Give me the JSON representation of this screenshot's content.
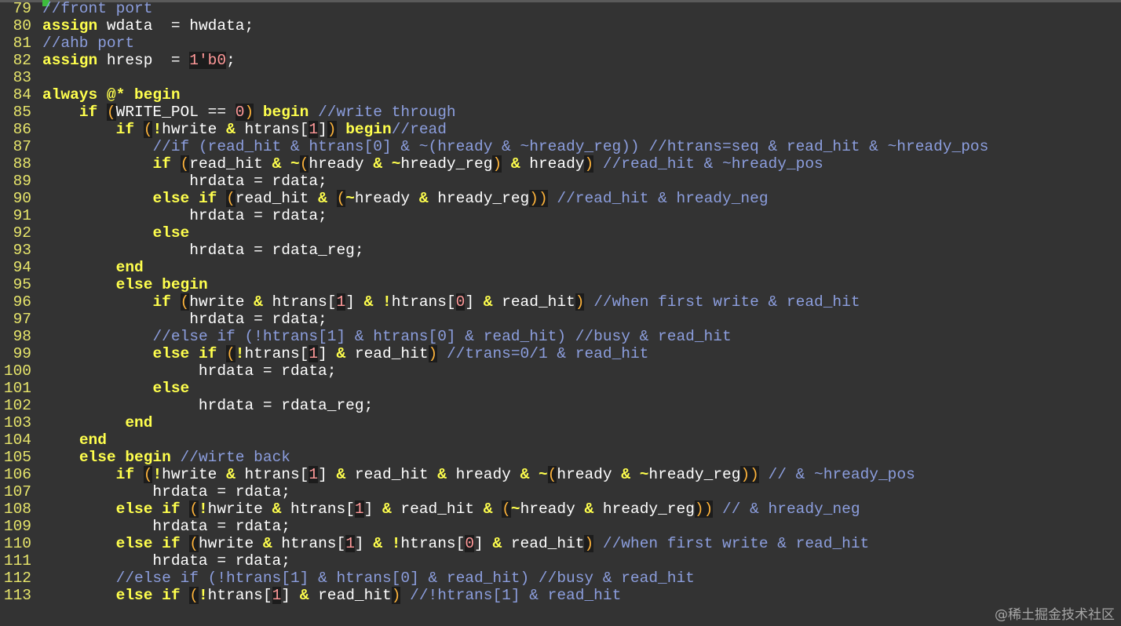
{
  "editor": {
    "watermark": "@稀土掘金技术社区",
    "lines": [
      {
        "n": "79",
        "tokens": [
          [
            "cm",
            "//front port"
          ]
        ]
      },
      {
        "n": "80",
        "tokens": [
          [
            "kw",
            "assign"
          ],
          [
            "id",
            " wdata  = hwdata;"
          ]
        ]
      },
      {
        "n": "81",
        "tokens": [
          [
            "cm",
            "//ahb port"
          ]
        ]
      },
      {
        "n": "82",
        "tokens": [
          [
            "kw",
            "assign"
          ],
          [
            "id",
            " hresp  = "
          ],
          [
            "num",
            "1'b0"
          ],
          [
            "id",
            ";"
          ]
        ]
      },
      {
        "n": "83",
        "tokens": []
      },
      {
        "n": "84",
        "tokens": [
          [
            "kw",
            "always @* begin"
          ]
        ]
      },
      {
        "n": "85",
        "tokens": [
          [
            "id",
            "    "
          ],
          [
            "kw",
            "if"
          ],
          [
            "id",
            " "
          ],
          [
            "br",
            "("
          ],
          [
            "id",
            "WRITE_POL == "
          ],
          [
            "num",
            "0"
          ],
          [
            "br",
            ")"
          ],
          [
            "id",
            " "
          ],
          [
            "kw",
            "begin"
          ],
          [
            "id",
            " "
          ],
          [
            "cm",
            "//write through"
          ]
        ]
      },
      {
        "n": "86",
        "tokens": [
          [
            "id",
            "        "
          ],
          [
            "kw",
            "if"
          ],
          [
            "id",
            " "
          ],
          [
            "br",
            "("
          ],
          [
            "kw",
            "!"
          ],
          [
            "id",
            "hwrite "
          ],
          [
            "kw",
            "&"
          ],
          [
            "id",
            " htrans["
          ],
          [
            "num",
            "1"
          ],
          [
            "id",
            "]"
          ],
          [
            "br",
            ")"
          ],
          [
            "id",
            " "
          ],
          [
            "kw",
            "begin"
          ],
          [
            "cm",
            "//read"
          ]
        ]
      },
      {
        "n": "87",
        "tokens": [
          [
            "id",
            "            "
          ],
          [
            "cm",
            "//if (read_hit & htrans[0] & ~(hready & ~hready_reg)) //htrans=seq & read_hit & ~hready_pos"
          ]
        ]
      },
      {
        "n": "88",
        "tokens": [
          [
            "id",
            "            "
          ],
          [
            "kw",
            "if"
          ],
          [
            "id",
            " "
          ],
          [
            "br",
            "("
          ],
          [
            "id",
            "read_hit "
          ],
          [
            "kw",
            "&"
          ],
          [
            "id",
            " "
          ],
          [
            "kw",
            "~"
          ],
          [
            "br",
            "("
          ],
          [
            "id",
            "hready "
          ],
          [
            "kw",
            "&"
          ],
          [
            "id",
            " "
          ],
          [
            "kw",
            "~"
          ],
          [
            "id",
            "hready_reg"
          ],
          [
            "br",
            ")"
          ],
          [
            "id",
            " "
          ],
          [
            "kw",
            "&"
          ],
          [
            "id",
            " hready"
          ],
          [
            "br",
            ")"
          ],
          [
            "id",
            " "
          ],
          [
            "cm",
            "//read_hit & ~hready_pos"
          ]
        ]
      },
      {
        "n": "89",
        "tokens": [
          [
            "id",
            "                hrdata = rdata;"
          ]
        ]
      },
      {
        "n": "90",
        "tokens": [
          [
            "id",
            "            "
          ],
          [
            "kw",
            "else if"
          ],
          [
            "id",
            " "
          ],
          [
            "br",
            "("
          ],
          [
            "id",
            "read_hit "
          ],
          [
            "kw",
            "&"
          ],
          [
            "id",
            " "
          ],
          [
            "br",
            "("
          ],
          [
            "kw",
            "~"
          ],
          [
            "id",
            "hready "
          ],
          [
            "kw",
            "&"
          ],
          [
            "id",
            " hready_reg"
          ],
          [
            "br",
            "))"
          ],
          [
            "id",
            " "
          ],
          [
            "cm",
            "//read_hit & hready_neg"
          ]
        ]
      },
      {
        "n": "91",
        "tokens": [
          [
            "id",
            "                hrdata = rdata;"
          ]
        ]
      },
      {
        "n": "92",
        "tokens": [
          [
            "id",
            "            "
          ],
          [
            "kw",
            "else"
          ]
        ]
      },
      {
        "n": "93",
        "tokens": [
          [
            "id",
            "                hrdata = rdata_reg;"
          ]
        ]
      },
      {
        "n": "94",
        "tokens": [
          [
            "id",
            "        "
          ],
          [
            "kw",
            "end"
          ]
        ]
      },
      {
        "n": "95",
        "tokens": [
          [
            "id",
            "        "
          ],
          [
            "kw",
            "else begin"
          ]
        ]
      },
      {
        "n": "96",
        "tokens": [
          [
            "id",
            "            "
          ],
          [
            "kw",
            "if"
          ],
          [
            "id",
            " "
          ],
          [
            "br",
            "("
          ],
          [
            "id",
            "hwrite "
          ],
          [
            "kw",
            "&"
          ],
          [
            "id",
            " htrans["
          ],
          [
            "num",
            "1"
          ],
          [
            "id",
            "] "
          ],
          [
            "kw",
            "&"
          ],
          [
            "id",
            " "
          ],
          [
            "kw",
            "!"
          ],
          [
            "id",
            "htrans["
          ],
          [
            "num",
            "0"
          ],
          [
            "id",
            "] "
          ],
          [
            "kw",
            "&"
          ],
          [
            "id",
            " read_hit"
          ],
          [
            "br",
            ")"
          ],
          [
            "id",
            " "
          ],
          [
            "cm",
            "//when first write & read_hit"
          ]
        ]
      },
      {
        "n": "97",
        "tokens": [
          [
            "id",
            "                hrdata = rdata;"
          ]
        ]
      },
      {
        "n": "98",
        "tokens": [
          [
            "id",
            "            "
          ],
          [
            "cm",
            "//else if (!htrans[1] & htrans[0] & read_hit) //busy & read_hit"
          ]
        ]
      },
      {
        "n": "99",
        "tokens": [
          [
            "id",
            "            "
          ],
          [
            "kw",
            "else if"
          ],
          [
            "id",
            " "
          ],
          [
            "br",
            "("
          ],
          [
            "kw",
            "!"
          ],
          [
            "id",
            "htrans["
          ],
          [
            "num",
            "1"
          ],
          [
            "id",
            "] "
          ],
          [
            "kw",
            "&"
          ],
          [
            "id",
            " read_hit"
          ],
          [
            "br",
            ")"
          ],
          [
            "id",
            " "
          ],
          [
            "cm",
            "//trans=0/1 & read_hit"
          ]
        ]
      },
      {
        "n": "100",
        "tokens": [
          [
            "id",
            "                 hrdata = rdata;"
          ]
        ]
      },
      {
        "n": "101",
        "tokens": [
          [
            "id",
            "            "
          ],
          [
            "kw",
            "else"
          ]
        ]
      },
      {
        "n": "102",
        "tokens": [
          [
            "id",
            "                 hrdata = rdata_reg;"
          ]
        ]
      },
      {
        "n": "103",
        "tokens": [
          [
            "id",
            "         "
          ],
          [
            "kw",
            "end"
          ]
        ]
      },
      {
        "n": "104",
        "tokens": [
          [
            "id",
            "    "
          ],
          [
            "kw",
            "end"
          ]
        ]
      },
      {
        "n": "105",
        "tokens": [
          [
            "id",
            "    "
          ],
          [
            "kw",
            "else begin"
          ],
          [
            "id",
            " "
          ],
          [
            "cm",
            "//wirte back"
          ]
        ]
      },
      {
        "n": "106",
        "tokens": [
          [
            "id",
            "        "
          ],
          [
            "kw",
            "if"
          ],
          [
            "id",
            " "
          ],
          [
            "br",
            "("
          ],
          [
            "kw",
            "!"
          ],
          [
            "id",
            "hwrite "
          ],
          [
            "kw",
            "&"
          ],
          [
            "id",
            " htrans["
          ],
          [
            "num",
            "1"
          ],
          [
            "id",
            "] "
          ],
          [
            "kw",
            "&"
          ],
          [
            "id",
            " read_hit "
          ],
          [
            "kw",
            "&"
          ],
          [
            "id",
            " hready "
          ],
          [
            "kw",
            "&"
          ],
          [
            "id",
            " "
          ],
          [
            "kw",
            "~"
          ],
          [
            "br",
            "("
          ],
          [
            "id",
            "hready "
          ],
          [
            "kw",
            "&"
          ],
          [
            "id",
            " "
          ],
          [
            "kw",
            "~"
          ],
          [
            "id",
            "hready_reg"
          ],
          [
            "br",
            "))"
          ],
          [
            "id",
            " "
          ],
          [
            "cm",
            "// & ~hready_pos"
          ]
        ]
      },
      {
        "n": "107",
        "tokens": [
          [
            "id",
            "            hrdata = rdata;"
          ]
        ]
      },
      {
        "n": "108",
        "tokens": [
          [
            "id",
            "        "
          ],
          [
            "kw",
            "else if"
          ],
          [
            "id",
            " "
          ],
          [
            "br",
            "("
          ],
          [
            "kw",
            "!"
          ],
          [
            "id",
            "hwrite "
          ],
          [
            "kw",
            "&"
          ],
          [
            "id",
            " htrans["
          ],
          [
            "num",
            "1"
          ],
          [
            "id",
            "] "
          ],
          [
            "kw",
            "&"
          ],
          [
            "id",
            " read_hit "
          ],
          [
            "kw",
            "&"
          ],
          [
            "id",
            " "
          ],
          [
            "br",
            "("
          ],
          [
            "kw",
            "~"
          ],
          [
            "id",
            "hready "
          ],
          [
            "kw",
            "&"
          ],
          [
            "id",
            " hready_reg"
          ],
          [
            "br",
            "))"
          ],
          [
            "id",
            " "
          ],
          [
            "cm",
            "// & hready_neg"
          ]
        ]
      },
      {
        "n": "109",
        "tokens": [
          [
            "id",
            "            hrdata = rdata;"
          ]
        ]
      },
      {
        "n": "110",
        "tokens": [
          [
            "id",
            "        "
          ],
          [
            "kw",
            "else if"
          ],
          [
            "id",
            " "
          ],
          [
            "br",
            "("
          ],
          [
            "id",
            "hwrite "
          ],
          [
            "kw",
            "&"
          ],
          [
            "id",
            " htrans["
          ],
          [
            "num",
            "1"
          ],
          [
            "id",
            "] "
          ],
          [
            "kw",
            "&"
          ],
          [
            "id",
            " "
          ],
          [
            "kw",
            "!"
          ],
          [
            "id",
            "htrans["
          ],
          [
            "num",
            "0"
          ],
          [
            "id",
            "] "
          ],
          [
            "kw",
            "&"
          ],
          [
            "id",
            " read_hit"
          ],
          [
            "br",
            ")"
          ],
          [
            "id",
            " "
          ],
          [
            "cm",
            "//when first write & read_hit"
          ]
        ]
      },
      {
        "n": "111",
        "tokens": [
          [
            "id",
            "            hrdata = rdata;"
          ]
        ]
      },
      {
        "n": "112",
        "tokens": [
          [
            "id",
            "        "
          ],
          [
            "cm",
            "//else if (!htrans[1] & htrans[0] & read_hit) //busy & read_hit"
          ]
        ]
      },
      {
        "n": "113",
        "tokens": [
          [
            "id",
            "        "
          ],
          [
            "kw",
            "else if"
          ],
          [
            "id",
            " "
          ],
          [
            "br",
            "("
          ],
          [
            "kw",
            "!"
          ],
          [
            "id",
            "htrans["
          ],
          [
            "num",
            "1"
          ],
          [
            "id",
            "] "
          ],
          [
            "kw",
            "&"
          ],
          [
            "id",
            " read_hit"
          ],
          [
            "br",
            ")"
          ],
          [
            "id",
            " "
          ],
          [
            "cm",
            "//!htrans[1] & read_hit"
          ]
        ]
      }
    ]
  }
}
